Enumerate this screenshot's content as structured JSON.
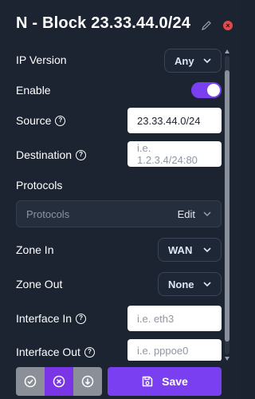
{
  "header": {
    "title": "N - Block 23.33.44.0/24"
  },
  "fields": {
    "ip_version": {
      "label": "IP Version",
      "value": "Any"
    },
    "enable": {
      "label": "Enable",
      "on": true
    },
    "source": {
      "label": "Source",
      "value": "23.33.44.0/24"
    },
    "destination": {
      "label": "Destination",
      "placeholder": "i.e. 1.2.3.4/24:80"
    },
    "protocols": {
      "label": "Protocols",
      "placeholder": "Protocols",
      "edit_label": "Edit"
    },
    "zone_in": {
      "label": "Zone In",
      "value": "WAN"
    },
    "zone_out": {
      "label": "Zone Out",
      "value": "None"
    },
    "interface_in": {
      "label": "Interface In",
      "placeholder": "i.e. eth3"
    },
    "interface_out": {
      "label": "Interface Out",
      "placeholder": "i.e. pppoe0"
    }
  },
  "footer": {
    "save_label": "Save"
  },
  "icons": {
    "help": "?",
    "close": "×"
  },
  "colors": {
    "accent": "#7b3ff2",
    "background": "#1c2331",
    "close": "#e04a4a"
  }
}
